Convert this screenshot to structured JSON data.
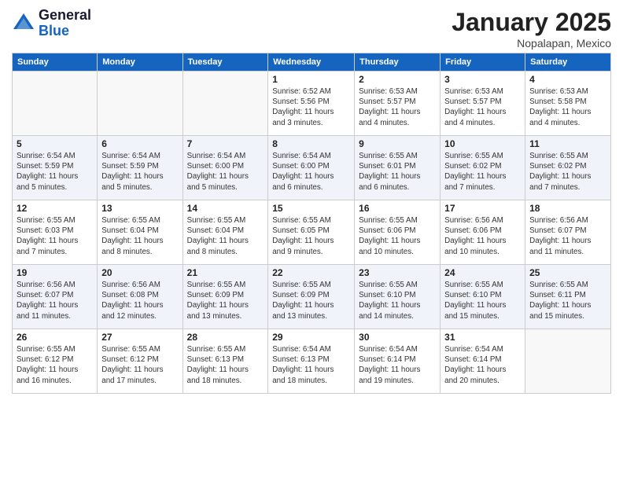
{
  "header": {
    "logo": {
      "general": "General",
      "blue": "Blue"
    },
    "month_title": "January 2025",
    "subtitle": "Nopalapan, Mexico"
  },
  "days_of_week": [
    "Sunday",
    "Monday",
    "Tuesday",
    "Wednesday",
    "Thursday",
    "Friday",
    "Saturday"
  ],
  "weeks": [
    [
      {
        "day": "",
        "info": ""
      },
      {
        "day": "",
        "info": ""
      },
      {
        "day": "",
        "info": ""
      },
      {
        "day": "1",
        "info": "Sunrise: 6:52 AM\nSunset: 5:56 PM\nDaylight: 11 hours\nand 3 minutes."
      },
      {
        "day": "2",
        "info": "Sunrise: 6:53 AM\nSunset: 5:57 PM\nDaylight: 11 hours\nand 4 minutes."
      },
      {
        "day": "3",
        "info": "Sunrise: 6:53 AM\nSunset: 5:57 PM\nDaylight: 11 hours\nand 4 minutes."
      },
      {
        "day": "4",
        "info": "Sunrise: 6:53 AM\nSunset: 5:58 PM\nDaylight: 11 hours\nand 4 minutes."
      }
    ],
    [
      {
        "day": "5",
        "info": "Sunrise: 6:54 AM\nSunset: 5:59 PM\nDaylight: 11 hours\nand 5 minutes."
      },
      {
        "day": "6",
        "info": "Sunrise: 6:54 AM\nSunset: 5:59 PM\nDaylight: 11 hours\nand 5 minutes."
      },
      {
        "day": "7",
        "info": "Sunrise: 6:54 AM\nSunset: 6:00 PM\nDaylight: 11 hours\nand 5 minutes."
      },
      {
        "day": "8",
        "info": "Sunrise: 6:54 AM\nSunset: 6:00 PM\nDaylight: 11 hours\nand 6 minutes."
      },
      {
        "day": "9",
        "info": "Sunrise: 6:55 AM\nSunset: 6:01 PM\nDaylight: 11 hours\nand 6 minutes."
      },
      {
        "day": "10",
        "info": "Sunrise: 6:55 AM\nSunset: 6:02 PM\nDaylight: 11 hours\nand 7 minutes."
      },
      {
        "day": "11",
        "info": "Sunrise: 6:55 AM\nSunset: 6:02 PM\nDaylight: 11 hours\nand 7 minutes."
      }
    ],
    [
      {
        "day": "12",
        "info": "Sunrise: 6:55 AM\nSunset: 6:03 PM\nDaylight: 11 hours\nand 7 minutes."
      },
      {
        "day": "13",
        "info": "Sunrise: 6:55 AM\nSunset: 6:04 PM\nDaylight: 11 hours\nand 8 minutes."
      },
      {
        "day": "14",
        "info": "Sunrise: 6:55 AM\nSunset: 6:04 PM\nDaylight: 11 hours\nand 8 minutes."
      },
      {
        "day": "15",
        "info": "Sunrise: 6:55 AM\nSunset: 6:05 PM\nDaylight: 11 hours\nand 9 minutes."
      },
      {
        "day": "16",
        "info": "Sunrise: 6:55 AM\nSunset: 6:06 PM\nDaylight: 11 hours\nand 10 minutes."
      },
      {
        "day": "17",
        "info": "Sunrise: 6:56 AM\nSunset: 6:06 PM\nDaylight: 11 hours\nand 10 minutes."
      },
      {
        "day": "18",
        "info": "Sunrise: 6:56 AM\nSunset: 6:07 PM\nDaylight: 11 hours\nand 11 minutes."
      }
    ],
    [
      {
        "day": "19",
        "info": "Sunrise: 6:56 AM\nSunset: 6:07 PM\nDaylight: 11 hours\nand 11 minutes."
      },
      {
        "day": "20",
        "info": "Sunrise: 6:56 AM\nSunset: 6:08 PM\nDaylight: 11 hours\nand 12 minutes."
      },
      {
        "day": "21",
        "info": "Sunrise: 6:55 AM\nSunset: 6:09 PM\nDaylight: 11 hours\nand 13 minutes."
      },
      {
        "day": "22",
        "info": "Sunrise: 6:55 AM\nSunset: 6:09 PM\nDaylight: 11 hours\nand 13 minutes."
      },
      {
        "day": "23",
        "info": "Sunrise: 6:55 AM\nSunset: 6:10 PM\nDaylight: 11 hours\nand 14 minutes."
      },
      {
        "day": "24",
        "info": "Sunrise: 6:55 AM\nSunset: 6:10 PM\nDaylight: 11 hours\nand 15 minutes."
      },
      {
        "day": "25",
        "info": "Sunrise: 6:55 AM\nSunset: 6:11 PM\nDaylight: 11 hours\nand 15 minutes."
      }
    ],
    [
      {
        "day": "26",
        "info": "Sunrise: 6:55 AM\nSunset: 6:12 PM\nDaylight: 11 hours\nand 16 minutes."
      },
      {
        "day": "27",
        "info": "Sunrise: 6:55 AM\nSunset: 6:12 PM\nDaylight: 11 hours\nand 17 minutes."
      },
      {
        "day": "28",
        "info": "Sunrise: 6:55 AM\nSunset: 6:13 PM\nDaylight: 11 hours\nand 18 minutes."
      },
      {
        "day": "29",
        "info": "Sunrise: 6:54 AM\nSunset: 6:13 PM\nDaylight: 11 hours\nand 18 minutes."
      },
      {
        "day": "30",
        "info": "Sunrise: 6:54 AM\nSunset: 6:14 PM\nDaylight: 11 hours\nand 19 minutes."
      },
      {
        "day": "31",
        "info": "Sunrise: 6:54 AM\nSunset: 6:14 PM\nDaylight: 11 hours\nand 20 minutes."
      },
      {
        "day": "",
        "info": ""
      }
    ]
  ]
}
